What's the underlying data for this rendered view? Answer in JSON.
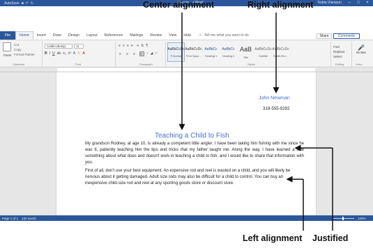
{
  "titlebar": {
    "autosave": "AutoSave",
    "title": "Docum... • Word",
    "user": "Tedda Vlampon",
    "minimize": "–",
    "maximize": "□",
    "close": "×"
  },
  "tabs": [
    "File",
    "Home",
    "Insert",
    "Draw",
    "Design",
    "Layout",
    "References",
    "Mailings",
    "Review",
    "View",
    "Help"
  ],
  "active_tab": "Home",
  "tell_me": "Tell me what you want to do",
  "share": "Share",
  "comments": "Comments",
  "ribbon": {
    "clipboard": {
      "paste": "Paste",
      "cut": "Cut",
      "copy": "Copy",
      "format_painter": "Format Painter",
      "label": "Clipboard"
    },
    "font": {
      "name": "Calibri (Body)",
      "size": "11",
      "label": "Font"
    },
    "paragraph": {
      "label": "Paragraph"
    },
    "styles": {
      "label": "Styles",
      "items": [
        {
          "preview": "AaBbCcDc",
          "name": "¶ Normal"
        },
        {
          "preview": "AaBbCcDc",
          "name": "¶ No Spac..."
        },
        {
          "preview": "AaBbCc",
          "name": "Heading 1"
        },
        {
          "preview": "AaBbCc",
          "name": "Heading 2"
        },
        {
          "preview": "AaB",
          "name": "Title"
        },
        {
          "preview": "AaBbCcDc",
          "name": "Subtitle"
        },
        {
          "preview": "AaBbCcDc",
          "name": "Subtle Em..."
        }
      ]
    },
    "editing": {
      "find": "Find",
      "replace": "Replace",
      "select": "Select",
      "label": "Editing"
    },
    "voice": {
      "dictate": "Dictate",
      "label": "Voice"
    }
  },
  "document": {
    "name": "John Newman",
    "phone": "319-555-9292",
    "title": "Teaching a Child to Fish",
    "paragraph1": "My grandson Rodney, at age 10, is already a competent little angler. I have been taking him fishing with me since he was 6, patiently teaching him the tips and tricks that my father taught me. Along the way, I have learned a little something about what does and doesn't work in teaching a child to fish, and I would like to share that information with you.",
    "paragraph2": "First of all, don't use your best equipment. An expensive rod and reel is wasted on a child, and you will likely be nervous about it getting damaged. Adult size rods may also be difficult for a child to control. You can buy an inexpensive child-size rod and reel at any sporting goods store or discount store."
  },
  "statusbar": {
    "page": "Page 1 of 1",
    "words": "132 words",
    "zoom": "120%"
  },
  "callouts": {
    "center": "Center alignment",
    "right": "Right alignment",
    "left": "Left alignment",
    "justified": "Justified"
  },
  "colors": {
    "accent": "#2b579a",
    "heading": "#4472c4"
  }
}
